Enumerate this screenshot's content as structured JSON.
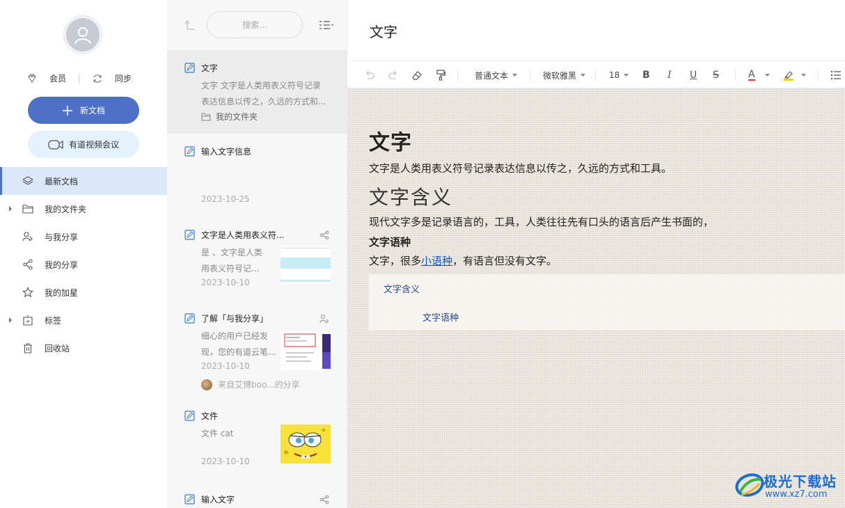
{
  "sidebar": {
    "member_label": "会员",
    "sync_label": "同步",
    "new_doc_label": "新文档",
    "video_meeting_label": "有道视频会议",
    "nav": [
      {
        "label": "最新文档",
        "icon": "layers-icon",
        "active": true
      },
      {
        "label": "我的文件夹",
        "icon": "folder-icon",
        "has_arrow": true
      },
      {
        "label": "与我分享",
        "icon": "shared-with-me-icon"
      },
      {
        "label": "我的分享",
        "icon": "share-icon"
      },
      {
        "label": "我的加星",
        "icon": "star-icon"
      },
      {
        "label": "标签",
        "icon": "tag-icon",
        "has_arrow": true
      },
      {
        "label": "回收站",
        "icon": "trash-icon"
      }
    ]
  },
  "list": {
    "search_placeholder": "搜索...",
    "docs": [
      {
        "title": "文字",
        "snippet_1": "文字 文字是人类用表义符号记录",
        "snippet_2": "表达信息以传之，久远的方式和...",
        "folder": "我的文件夹",
        "selected": true
      },
      {
        "title": "输入文字信息",
        "date": "2023-10-25"
      },
      {
        "title": "文字是人类用表义符...",
        "snippet_1": "是 、文字是人类",
        "snippet_2": "用表义符号记...",
        "date": "2023-10-10",
        "shared": true
      },
      {
        "title": "了解「与我分享」",
        "snippet_1": "细心的用户已经发",
        "snippet_2": "现，您的有道云笔...",
        "date": "2023-10-10",
        "from": "来自艾博boo...的分享"
      },
      {
        "title": "文件",
        "snippet_1": "文件 cat",
        "date": "2023-10-10"
      },
      {
        "title": "输入文字",
        "shared": true
      }
    ]
  },
  "editor": {
    "title": "文字",
    "toolbar": {
      "paragraph_style": "普通文本",
      "font_family": "微软雅黑",
      "font_size": "18",
      "bold": "B",
      "italic": "I",
      "underline": "U",
      "strike": "S",
      "font_color": "A"
    },
    "content": {
      "h1": "文字",
      "p1": "文字是人类用表义符号记录表达信息以传之，久远的方式和工具。",
      "h2": "文字含义",
      "p2": "现代文字多是记录语言的，工具，人类往往先有口头的语言后产生书面的，",
      "h3": "文字语种",
      "p3_before": "文字，很多",
      "p3_link": "小语种",
      "p3_after": "，有语言但没有文字。",
      "toc": [
        "文字含义",
        "文字语种"
      ]
    }
  },
  "watermark": {
    "text": "极光下载站",
    "url": "www.xz7.com"
  },
  "colors": {
    "accent": "#4e71c5",
    "active_nav_bg": "#dbe8fb",
    "video_btn_bg": "#e3f2fc",
    "link": "#1a56b8"
  }
}
